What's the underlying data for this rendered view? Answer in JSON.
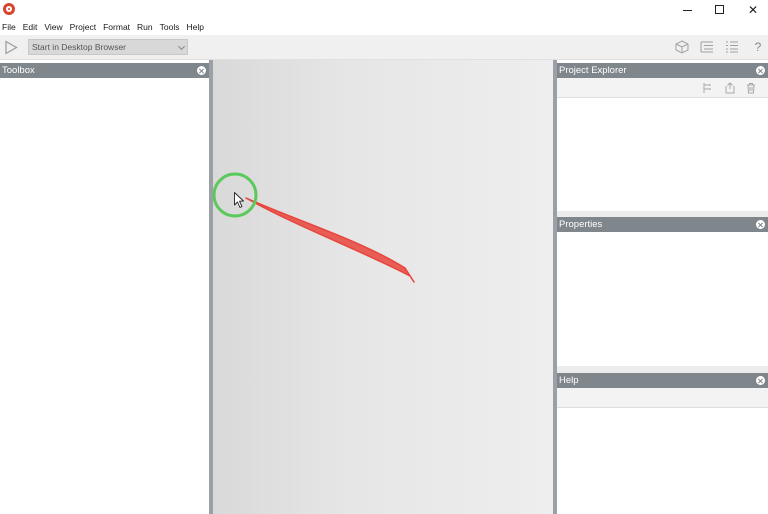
{
  "window": {
    "minimize_icon": "minimize-icon",
    "maximize_icon": "maximize-icon",
    "close_glyph": "✕"
  },
  "menu": [
    "File",
    "Edit",
    "View",
    "Project",
    "Format",
    "Run",
    "Tools",
    "Help"
  ],
  "toolbar": {
    "run_target": "Start in Desktop Browser",
    "help_glyph": "?"
  },
  "panels": {
    "toolbox": "Toolbox",
    "project_explorer": "Project Explorer",
    "properties": "Properties",
    "help": "Help"
  },
  "colors": {
    "panel_header": "#7f868c",
    "cursor_highlight": "#5cc95c",
    "annotation_stroke": "#e8453c",
    "app_icon": "#d9442c"
  }
}
